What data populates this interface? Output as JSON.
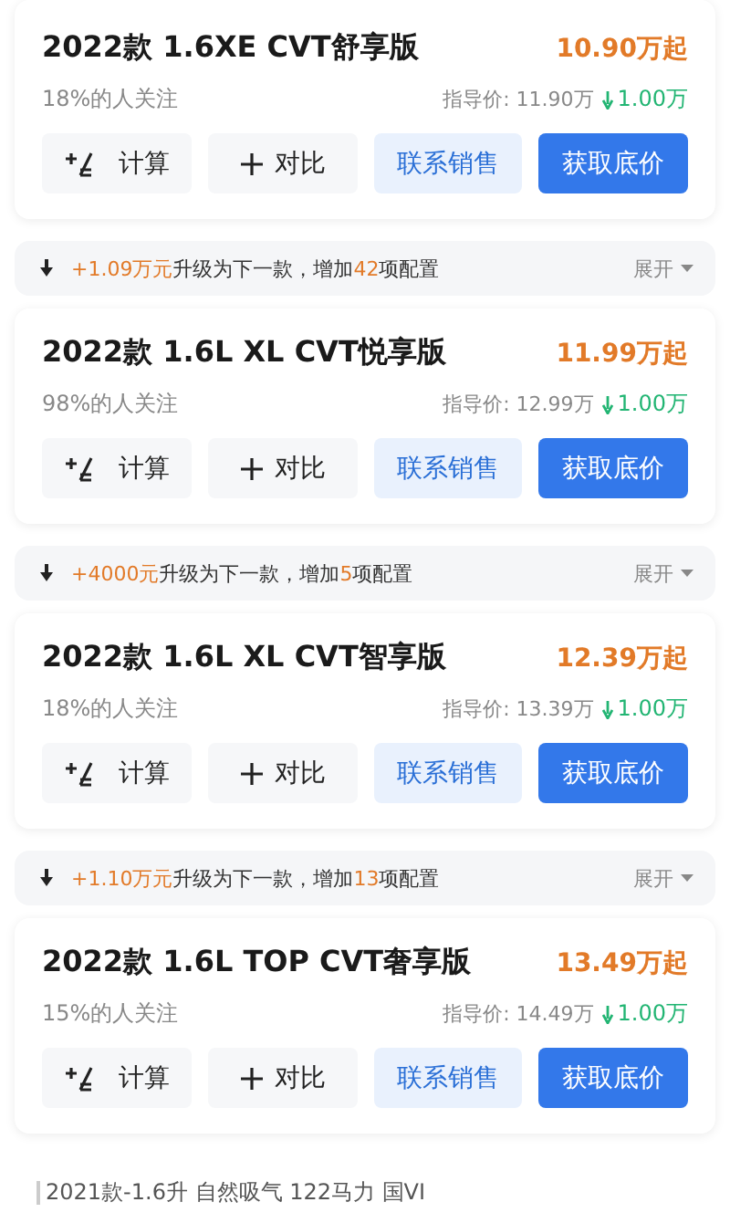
{
  "sections": [
    {
      "kind": "card",
      "title": "2022款 1.6XE CVT舒享版",
      "price": "10.90万起",
      "attention": "18%的人关注",
      "guide_label": "指导价:",
      "guide_price": "11.90万",
      "discount": "1.00万",
      "buttons": [
        {
          "kind": "calc",
          "label": "计算"
        },
        {
          "kind": "compare",
          "label": "对比"
        },
        {
          "kind": "contact",
          "label": "联系销售"
        },
        {
          "kind": "quote",
          "label": "获取底价"
        }
      ]
    },
    {
      "kind": "upgrade",
      "parts": [
        {
          "text": "+1.09万元",
          "highlight": true
        },
        {
          "text": "升级为下一款，增加",
          "highlight": false
        },
        {
          "text": "42",
          "highlight": true
        },
        {
          "text": "项配置",
          "highlight": false
        }
      ],
      "toggle": "展开"
    },
    {
      "kind": "card",
      "title": "2022款 1.6L XL CVT悦享版",
      "price": "11.99万起",
      "attention": "98%的人关注",
      "guide_label": "指导价:",
      "guide_price": "12.99万",
      "discount": "1.00万",
      "buttons": [
        {
          "kind": "calc",
          "label": "计算"
        },
        {
          "kind": "compare",
          "label": "对比"
        },
        {
          "kind": "contact",
          "label": "联系销售"
        },
        {
          "kind": "quote",
          "label": "获取底价"
        }
      ]
    },
    {
      "kind": "upgrade",
      "parts": [
        {
          "text": "+4000元",
          "highlight": true
        },
        {
          "text": "升级为下一款，增加",
          "highlight": false
        },
        {
          "text": "5",
          "highlight": true
        },
        {
          "text": "项配置",
          "highlight": false
        }
      ],
      "toggle": "展开"
    },
    {
      "kind": "card",
      "title": "2022款 1.6L XL CVT智享版",
      "price": "12.39万起",
      "attention": "18%的人关注",
      "guide_label": "指导价:",
      "guide_price": "13.39万",
      "discount": "1.00万",
      "buttons": [
        {
          "kind": "calc",
          "label": "计算"
        },
        {
          "kind": "compare",
          "label": "对比"
        },
        {
          "kind": "contact",
          "label": "联系销售"
        },
        {
          "kind": "quote",
          "label": "获取底价"
        }
      ]
    },
    {
      "kind": "upgrade",
      "parts": [
        {
          "text": "+1.10万元",
          "highlight": true
        },
        {
          "text": "升级为下一款，增加",
          "highlight": false
        },
        {
          "text": "13",
          "highlight": true
        },
        {
          "text": "项配置",
          "highlight": false
        }
      ],
      "toggle": "展开"
    },
    {
      "kind": "card",
      "title": "2022款 1.6L TOP CVT奢享版",
      "price": "13.49万起",
      "attention": "15%的人关注",
      "guide_label": "指导价:",
      "guide_price": "14.49万",
      "discount": "1.00万",
      "buttons": [
        {
          "kind": "calc",
          "label": "计算"
        },
        {
          "kind": "compare",
          "label": "对比"
        },
        {
          "kind": "contact",
          "label": "联系销售"
        },
        {
          "kind": "quote",
          "label": "获取底价"
        }
      ]
    }
  ],
  "footer": "2021款-1.6升 自然吸气 122马力 国VI"
}
